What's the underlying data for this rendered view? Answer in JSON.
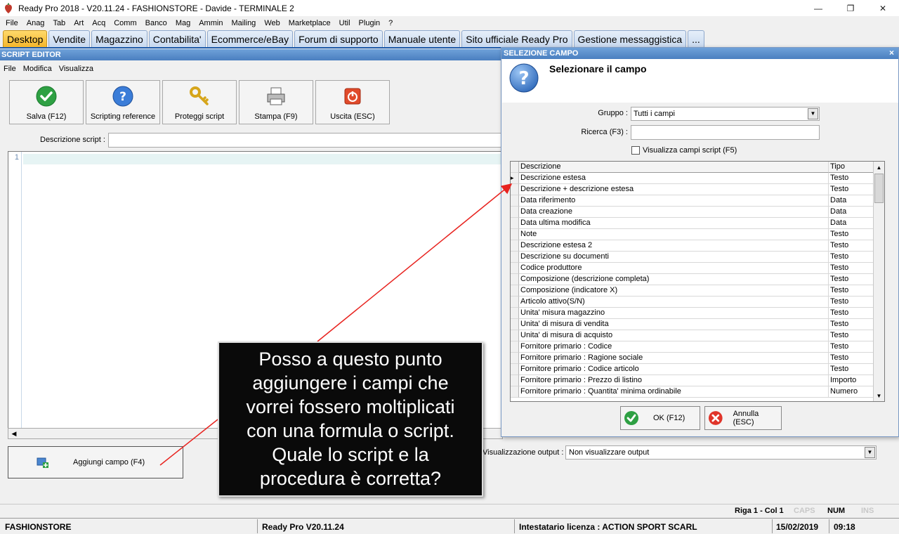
{
  "window": {
    "title": "Ready Pro 2018 - V20.11.24 - FASHIONSTORE - Davide - TERMINALE 2",
    "minimize": "—",
    "maximize": "❐",
    "close": "✕"
  },
  "menubar": [
    "File",
    "Anag",
    "Tab",
    "Art",
    "Acq",
    "Comm",
    "Banco",
    "Mag",
    "Ammin",
    "Mailing",
    "Web",
    "Marketplace",
    "Util",
    "Plugin",
    "?"
  ],
  "tabs": [
    {
      "label": "Desktop",
      "active": true
    },
    {
      "label": "Vendite"
    },
    {
      "label": "Magazzino"
    },
    {
      "label": "Contabilita'"
    },
    {
      "label": "Ecommerce/eBay"
    },
    {
      "label": "Forum di supporto"
    },
    {
      "label": "Manuale utente"
    },
    {
      "label": "Sito ufficiale Ready Pro"
    },
    {
      "label": "Gestione messaggistica"
    },
    {
      "label": "..."
    }
  ],
  "script_editor": {
    "title": "SCRIPT EDITOR",
    "menu": [
      "File",
      "Modifica",
      "Visualizza"
    ],
    "toolbar": [
      {
        "label": "Salva (F12)",
        "icon": "check-icon"
      },
      {
        "label": "Scripting reference",
        "icon": "help-icon"
      },
      {
        "label": "Proteggi script",
        "icon": "key-icon"
      },
      {
        "label": "Stampa (F9)",
        "icon": "printer-icon"
      },
      {
        "label": "Uscita (ESC)",
        "icon": "exit-icon"
      }
    ],
    "description_label": "Descrizione script :",
    "description_value": "",
    "line_number": "1",
    "add_field_label": "Aggiungi campo (F4)",
    "output_label": "Visualizzazione output :",
    "output_value": "Non visualizzare output"
  },
  "dialog": {
    "title": "SELEZIONE CAMPO",
    "close": "×",
    "heading": "Selezionare il campo",
    "group_label": "Gruppo :",
    "group_value": "Tutti i campi",
    "search_label": "Ricerca (F3) :",
    "search_value": "",
    "checkbox_label": "Visualizza campi script (F5)",
    "checkbox_checked": false,
    "columns": [
      "Descrizione",
      "Tipo"
    ],
    "rows": [
      {
        "desc": "Descrizione estesa",
        "tipo": "Testo"
      },
      {
        "desc": "Descrizione + descrizione estesa",
        "tipo": "Testo"
      },
      {
        "desc": "Data riferimento",
        "tipo": "Data"
      },
      {
        "desc": "Data creazione",
        "tipo": "Data"
      },
      {
        "desc": "Data ultima modifica",
        "tipo": "Data"
      },
      {
        "desc": "Note",
        "tipo": "Testo"
      },
      {
        "desc": "Descrizione estesa 2",
        "tipo": "Testo"
      },
      {
        "desc": "Descrizione su documenti",
        "tipo": "Testo"
      },
      {
        "desc": "Codice produttore",
        "tipo": "Testo"
      },
      {
        "desc": "Composizione (descrizione completa)",
        "tipo": "Testo"
      },
      {
        "desc": "Composizione (indicatore X)",
        "tipo": "Testo"
      },
      {
        "desc": "Articolo attivo(S/N)",
        "tipo": "Testo"
      },
      {
        "desc": "Unita' misura magazzino",
        "tipo": "Testo"
      },
      {
        "desc": "Unita' di misura di vendita",
        "tipo": "Testo"
      },
      {
        "desc": "Unita' di misura di acquisto",
        "tipo": "Testo"
      },
      {
        "desc": "Fornitore primario : Codice",
        "tipo": "Testo"
      },
      {
        "desc": "Fornitore primario : Ragione sociale",
        "tipo": "Testo"
      },
      {
        "desc": "Fornitore primario : Codice articolo",
        "tipo": "Testo"
      },
      {
        "desc": "Fornitore primario : Prezzo di listino",
        "tipo": "Importo"
      },
      {
        "desc": "Fornitore primario : Quantita' minima ordinabile",
        "tipo": "Numero"
      }
    ],
    "ok_label": "OK (F12)",
    "cancel_label": "Annulla (ESC)"
  },
  "callout": {
    "text_lines": [
      "Posso a questo punto",
      "aggiungere i campi che",
      "vorrei fossero moltiplicati",
      "con una formula o script.",
      "Quale lo script e la",
      "procedura è corretta?"
    ],
    "arrow_color": "#e8231f"
  },
  "status_bar": {
    "position": "Riga 1 - Col 1",
    "caps": "CAPS",
    "num": "NUM",
    "ins": "INS"
  },
  "bottom_bar": {
    "company": "FASHIONSTORE",
    "version": "Ready Pro V20.11.24",
    "license": "Intestatario licenza : ACTION SPORT SCARL",
    "date": "15/02/2019",
    "time": "09:18"
  },
  "colors": {
    "title_blue": "#4a7fc0",
    "active_tab": "#f5b62a",
    "accent_red": "#e8231f"
  }
}
